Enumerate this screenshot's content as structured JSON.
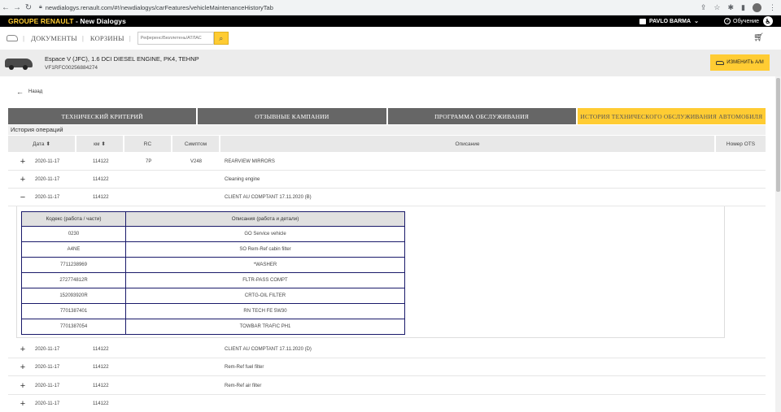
{
  "browser": {
    "url": "newdialogys.renault.com/#!/newdialogys/carFeatures/vehicleMaintenanceHistoryTab"
  },
  "header": {
    "brand_prefix": "GROUPE RENAULT",
    "brand_suffix": " - New Dialogys",
    "user_name": "PAVLO BARMA",
    "help_label": "Обучение"
  },
  "nav": {
    "documents": "ДОКУМЕНТЫ",
    "baskets": "КОРЗИНЫ",
    "search_placeholder": "Референс/Бюллетень/АТЛАС"
  },
  "vehicle": {
    "name": "Espace V (JFC), 1.6 DCI DIESEL ENGINE, PK4, TEHNP",
    "vin": "VF1RFC00256884274",
    "change_label": "ИЗМЕНИТЬ А/М"
  },
  "back_label": "Назад",
  "tabs": [
    {
      "label": "ТЕХНИЧЕСКИЙ КРИТЕРИЙ"
    },
    {
      "label": "ОТЗЫВНЫЕ КАМПАНИИ"
    },
    {
      "label": "ПРОГРАММА ОБСЛУЖИВАНИЯ"
    },
    {
      "label": "ИСТОРИЯ ТЕХНИЧЕСКОГО ОБСЛУЖИВАНИЯ АВТОМОБИЛЯ"
    }
  ],
  "section_title": "История операций",
  "table": {
    "headers": {
      "date": "Дата",
      "km": "км",
      "rc": "RC",
      "symptom": "Симптом",
      "description": "Описание",
      "ots": "Номер OTS"
    },
    "sort_icon": "⬍",
    "rows": [
      {
        "toggle": "+",
        "date": "2020-11-17",
        "km": "114122",
        "rc": "7P",
        "symptom": "V248",
        "description": "REARVIEW MIRRORS"
      },
      {
        "toggle": "+",
        "date": "2020-11-17",
        "km": "114122",
        "rc": "",
        "symptom": "",
        "description": "Cleaning engine"
      },
      {
        "toggle": "−",
        "date": "2020-11-17",
        "km": "114122",
        "rc": "",
        "symptom": "",
        "description": "CLIENT AU COMPTANT 17.11.2020 (B)"
      },
      {
        "toggle": "+",
        "date": "2020-11-17",
        "km": "114122",
        "rc": "",
        "symptom": "",
        "description": "CLIENT AU COMPTANT 17.11.2020 (D)"
      },
      {
        "toggle": "+",
        "date": "2020-11-17",
        "km": "114122",
        "rc": "",
        "symptom": "",
        "description": "Rem-Ref fuel filter"
      },
      {
        "toggle": "+",
        "date": "2020-11-17",
        "km": "114122",
        "rc": "",
        "symptom": "",
        "description": "Rem-Ref air filter"
      },
      {
        "toggle": "+",
        "date": "2020-11-17",
        "km": "114122",
        "rc": "",
        "symptom": "",
        "description": ""
      }
    ]
  },
  "details": {
    "header_code": "Кодекс (работа / части)",
    "header_desc": "Описания (работа и детали)",
    "rows": [
      {
        "code": "0230",
        "desc": "GO Service vehicle"
      },
      {
        "code": "A4NE",
        "desc": "SO Rem-Ref cabin filter"
      },
      {
        "code": "7711238969",
        "desc": "*WASHER"
      },
      {
        "code": "272774812R",
        "desc": "FLTR-PASS COMPT"
      },
      {
        "code": "152093920R",
        "desc": "CRTG-OIL FILTER"
      },
      {
        "code": "7701387401",
        "desc": "RN TECH FE 5W30"
      },
      {
        "code": "7701387054",
        "desc": "TOWBAR TRAFIC PH1"
      }
    ]
  }
}
